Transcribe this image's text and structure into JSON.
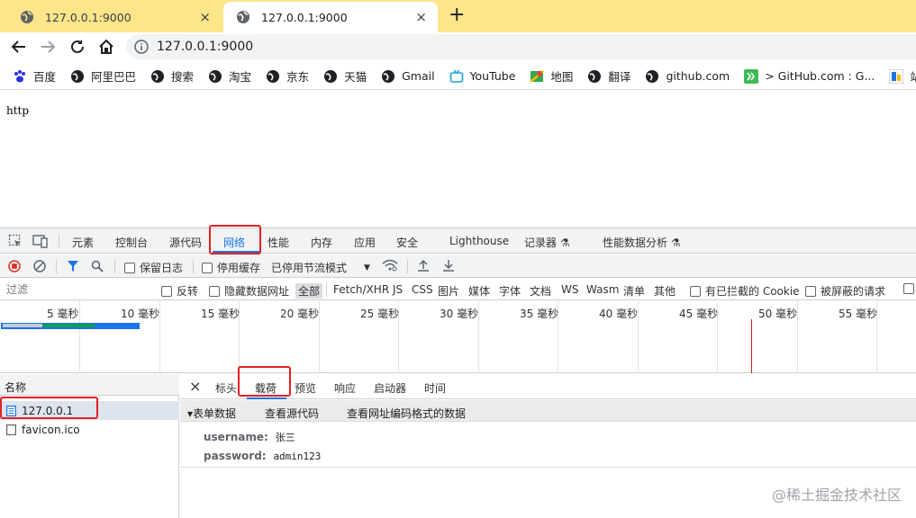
{
  "browser": {
    "tabs": [
      {
        "title": "127.0.0.1:9000",
        "close": "×"
      },
      {
        "title": "127.0.0.1:9000",
        "close": "×"
      }
    ],
    "new_tab": "+",
    "address": "127.0.0.1:9000",
    "bookmarks": [
      "百度",
      "阿里巴巴",
      "搜索",
      "淘宝",
      "京东",
      "天猫",
      "Gmail",
      "YouTube",
      "地图",
      "翻译",
      "github.com",
      "> GitHub.com : G...",
      "站长"
    ]
  },
  "page": {
    "body_text": "http"
  },
  "devtools": {
    "tabs": [
      "元素",
      "控制台",
      "源代码",
      "网络",
      "性能",
      "内存",
      "应用",
      "安全",
      "Lighthouse",
      "记录器 ⚗",
      "性能数据分析 ⚗"
    ],
    "toolbar": {
      "preserve_log": "保留日志",
      "disable_cache": "停用缓存",
      "throttle": "已停用节流模式"
    },
    "filter": {
      "placeholder": "过滤",
      "invert": "反转",
      "hide_data_urls": "隐藏数据网址",
      "types": [
        "全部",
        "Fetch/XHR",
        "JS",
        "CSS",
        "图片",
        "媒体",
        "字体",
        "文档",
        "WS",
        "Wasm",
        "清单",
        "其他"
      ],
      "blocked_cookies": "有已拦截的 Cookie",
      "blocked_requests": "被屏蔽的请求"
    },
    "timeline": {
      "labels": [
        "5 毫秒",
        "10 毫秒",
        "15 毫秒",
        "20 毫秒",
        "25 毫秒",
        "30 毫秒",
        "35 毫秒",
        "40 毫秒",
        "45 毫秒",
        "50 毫秒",
        "55 毫秒"
      ]
    },
    "requests": {
      "header": "名称",
      "items": [
        "127.0.0.1",
        "favicon.ico"
      ]
    },
    "detail": {
      "close": "×",
      "tabs": [
        "标头",
        "载荷",
        "预览",
        "响应",
        "启动器",
        "时间"
      ],
      "section_title": "▾表单数据",
      "view_source": "查看源代码",
      "view_url_encoded": "查看网址编码格式的数据",
      "fields": [
        {
          "key": "username:",
          "value": "张三"
        },
        {
          "key": "password:",
          "value": "admin123"
        }
      ]
    }
  },
  "watermark": "@稀土掘金技术社区",
  "colors": {
    "tab_strip": "#fde58a",
    "accent": "#1a73e8",
    "highlight_box": "#e32020"
  }
}
